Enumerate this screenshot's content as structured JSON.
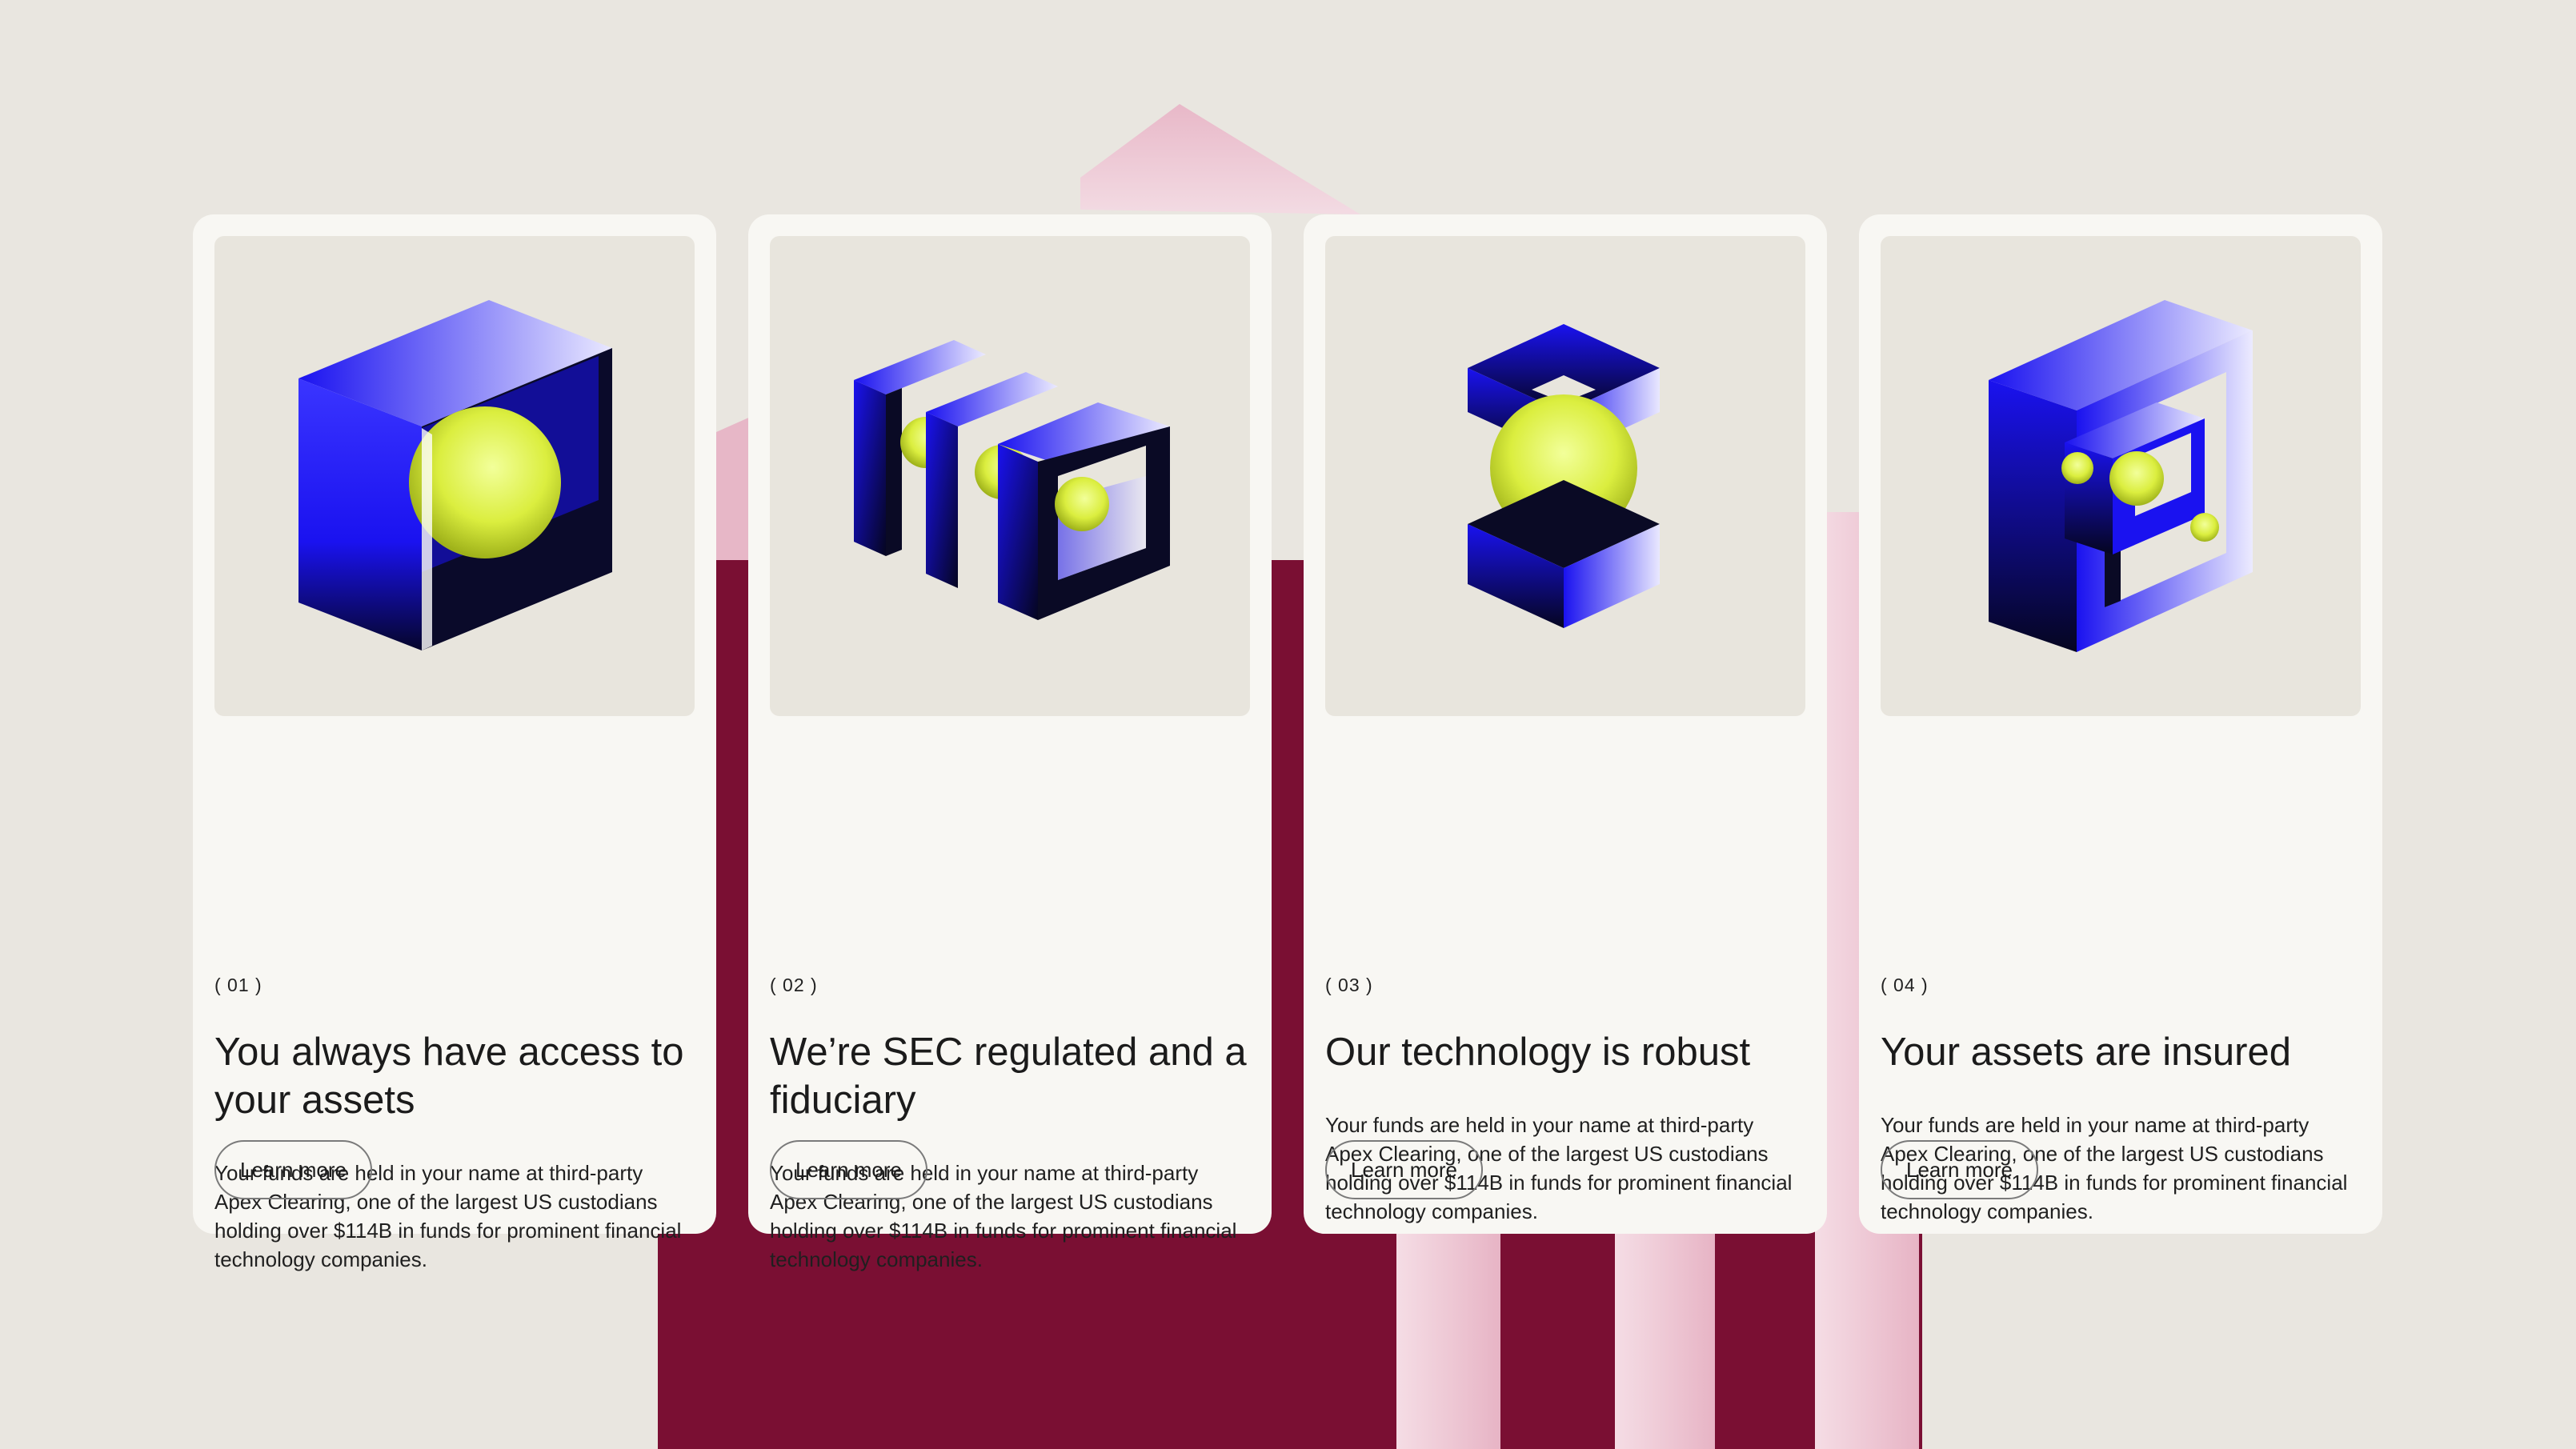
{
  "colors": {
    "background": "#e9e6e0",
    "card": "#f8f7f3",
    "art_panel": "#e8e5dd",
    "maroon": "#7a0f33",
    "pink": "#e6b6c6",
    "blue": "#1a12f0",
    "lime": "#dff050"
  },
  "cards": [
    {
      "number": "( 01 )",
      "title": "You always have access to your assets",
      "description": "Your funds are held in your name at third-party Apex Clearing, one of the largest US custodians holding over $114B in funds for prominent financial technology companies.",
      "button": "Learn more",
      "icon": "cube-with-sphere-icon"
    },
    {
      "number": "( 02 )",
      "title": "We’re SEC regulated and a fiduciary",
      "description": "Your funds are held in your name at third-party Apex Clearing, one of the largest US custodians holding over $114B in funds for prominent financial technology companies.",
      "button": "Learn more",
      "icon": "stacked-frames-icon"
    },
    {
      "number": "( 03 )",
      "title": "Our technology is robust",
      "description": "Your funds are held in your name at third-party Apex Clearing, one of the largest US custodians holding over $114B in funds for prominent financial technology companies.",
      "button": "Learn more",
      "icon": "sphere-between-blocks-icon"
    },
    {
      "number": "( 04 )",
      "title": "Your assets are insured",
      "description": "Your funds are held in your name at third-party Apex Clearing, one of the largest US custodians holding over $114B in funds for prominent financial technology companies.",
      "button": "Learn more",
      "icon": "nested-boxes-icon"
    }
  ]
}
